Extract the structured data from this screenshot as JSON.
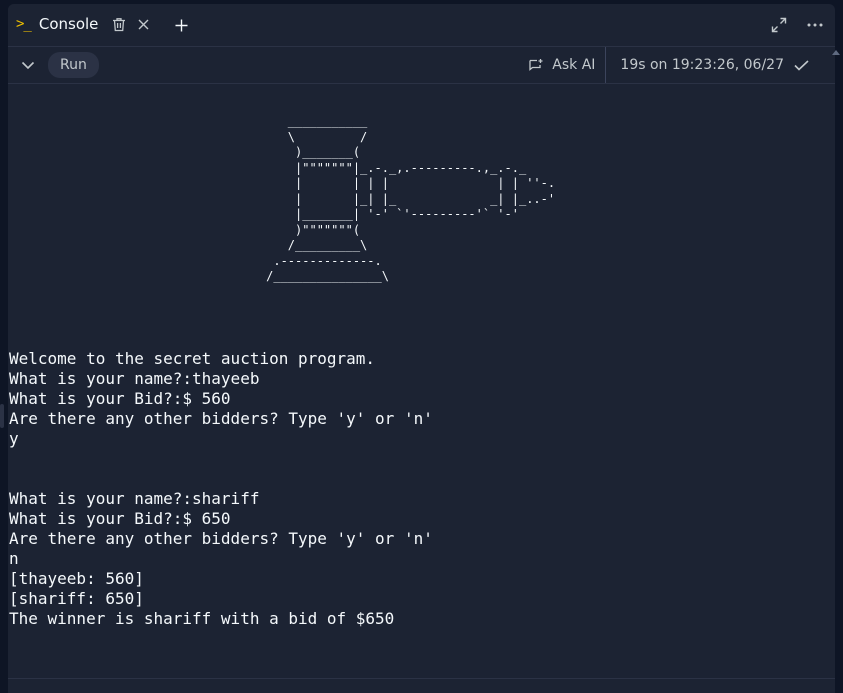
{
  "tab": {
    "prompt_glyph": ">_",
    "title": "Console"
  },
  "toolbar": {
    "run_label": "Run",
    "ask_ai_label": "Ask AI",
    "status_text": "19s on 19:23:26, 06/27"
  },
  "console": {
    "ascii_art": "        ___________\n        \\         /\n         )_______(\n         |\"\"\"\"\"\"\"|_.-._,.---------.,_.-._\n         |       | | |               | | ''-.\n         |       |_| |_             _| |_..-'\n         |_______| '-' `'---------'` '-'\n         )\"\"\"\"\"\"\"(\n        /_________\\\n      .-------------.\n     /_______________\\",
    "output": "Welcome to the secret auction program.\nWhat is your name?:thayeeb\nWhat is your Bid?:$ 560\nAre there any other bidders? Type 'y' or 'n'\ny\n\n\nWhat is your name?:shariff\nWhat is your Bid?:$ 650\nAre there any other bidders? Type 'y' or 'n'\nn\n[thayeeb: 560]\n[shariff: 650]\nThe winner is shariff with a bid of $650"
  }
}
